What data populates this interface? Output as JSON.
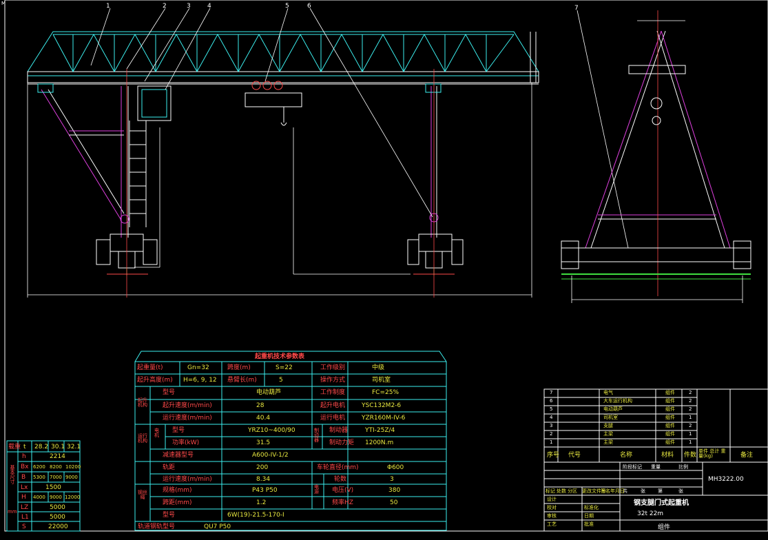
{
  "frame_label": "M",
  "params_table": {
    "title": "起重机技术参数表",
    "r1": [
      "起重量(t)",
      "Gn=32",
      "跨度(m)",
      "S=22",
      "工作级别",
      "中级"
    ],
    "r2": [
      "起升高度(m)",
      "H=6, 9, 12",
      "悬臂长(m)",
      "5",
      "操作方式",
      "司机室"
    ],
    "lift_group": "起升机构",
    "lift_rows": [
      [
        "型号",
        "电动葫芦",
        "工作制度",
        "FC=25%"
      ],
      [
        "起升速度(m/min)",
        "28",
        "起升电机",
        "YSC132M2-6"
      ],
      [
        "运行速度(m/min)",
        "40.4",
        "运行电机",
        "YZR160M-IV-6"
      ]
    ],
    "travel_group": "运行机构",
    "motor_label": "电机",
    "travel_rows": [
      [
        "型号",
        "YRZ10~400/90",
        "制动器",
        "YTI-25Z/4"
      ],
      [
        "功率(kW)",
        "31.5",
        "制动力矩",
        "1200N.m"
      ]
    ],
    "brake_label": "制动器",
    "reducer_label": "减速器型号",
    "reducer_value": "A600-IV-1/2",
    "wheel_rows": [
      [
        "轨距",
        "200",
        "车轮直径(mm)",
        "Φ600"
      ],
      [
        "运行速度(m/min)",
        "8.34",
        "轮数",
        "3"
      ]
    ],
    "rail_group": "钢丝绳",
    "power_group": "电源",
    "rail_rows": [
      [
        "规格(mm)",
        "P43 P50",
        "电压(V)",
        "380"
      ],
      [
        "跨距(mm)",
        "1.2",
        "频率HZ",
        "50"
      ],
      [
        "型号",
        "6W(19)-21.5-170-I",
        "",
        ""
      ]
    ],
    "track_label": "轨道钢轨型号",
    "track_value": "QU7 P50"
  },
  "dims_table": {
    "header": [
      "载重",
      "t",
      "28.2",
      "30.1",
      "32.1"
    ],
    "side_label": "基本尺寸",
    "unit": "mm",
    "rows": [
      [
        "h",
        "2214"
      ],
      [
        "Bx",
        "6200",
        "8200",
        "10200"
      ],
      [
        "B",
        "5300",
        "7000",
        "9000"
      ],
      [
        "Lx",
        "1500"
      ],
      [
        "H",
        "4000",
        "9000",
        "12000"
      ],
      [
        "LZ",
        "5000"
      ],
      [
        "L1",
        "5000"
      ],
      [
        "S",
        "22000"
      ]
    ]
  },
  "parts_list": {
    "rows": [
      [
        "7",
        "",
        "电气",
        "",
        "组件",
        "2"
      ],
      [
        "6",
        "",
        "大车运行机构",
        "",
        "组件",
        "2"
      ],
      [
        "5",
        "",
        "电动葫芦",
        "",
        "组件",
        "2"
      ],
      [
        "4",
        "",
        "司机室",
        "",
        "组件",
        "1"
      ],
      [
        "3",
        "",
        "支腿",
        "",
        "组件",
        "2"
      ],
      [
        "2",
        "",
        "主梁",
        "",
        "组件",
        "1"
      ],
      [
        "1",
        "",
        "主梁",
        "",
        "组件",
        "1"
      ]
    ],
    "header": [
      "序号",
      "代号",
      "名称",
      "材料",
      "件数",
      "单件 总计 重量(kg)",
      "备注"
    ]
  },
  "title_block": {
    "drawing_no": "MH3222.00",
    "title": "钢支腿门式起重机",
    "subtitle": "32t  22m",
    "type": "组件",
    "marks": [
      "标记",
      "处数",
      "分区",
      "更改文件号",
      "签名",
      "年月日"
    ],
    "roles": [
      "设计",
      "校对",
      "审核",
      "工艺",
      "批准"
    ],
    "cols": [
      "阶段标记",
      "重量",
      "比例"
    ],
    "sheet": [
      "共",
      "张",
      "第",
      "张"
    ],
    "std": [
      "标准化",
      "日期"
    ]
  },
  "leaders": [
    "1",
    "2",
    "3",
    "4",
    "5",
    "6",
    "7"
  ],
  "colors": {
    "background": "#000000",
    "cyan": "#3cf0f0",
    "white": "#ffffff",
    "red": "#ff4a4a",
    "magenta": "#e040e0",
    "green": "#40e040",
    "yellow": "#e8e840"
  }
}
